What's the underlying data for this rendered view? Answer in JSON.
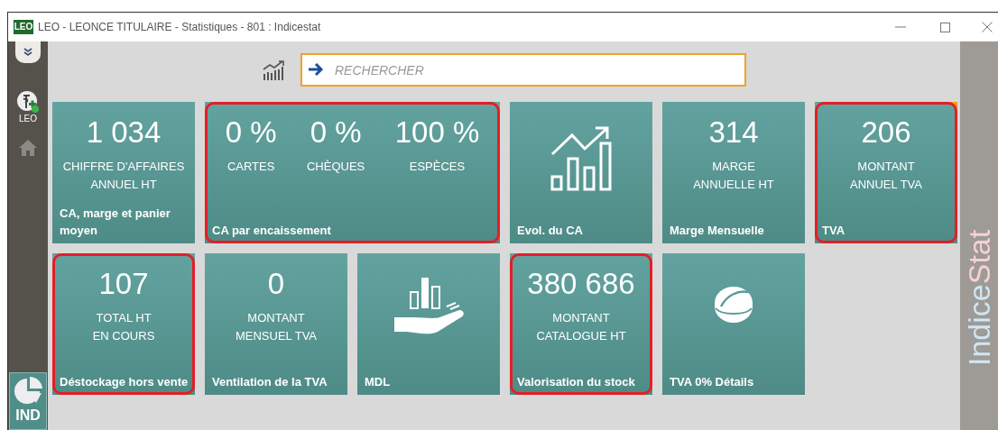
{
  "window": {
    "logo": "LEO",
    "title": "LEO - LEONCE TITULAIRE - Statistiques - 801 : Indicestat"
  },
  "sidebar": {
    "items": [
      {
        "kind": "user",
        "label": "LEO",
        "selected": false
      },
      {
        "kind": "home",
        "selected": false
      },
      {
        "kind": "module",
        "label": "IND",
        "selected": true
      }
    ]
  },
  "search": {
    "placeholder": "RECHERCHER"
  },
  "tiles": [
    {
      "kind": "figure",
      "value": "1 034",
      "label": "CHIFFRE D'AFFAIRES\nANNUEL HT",
      "title": "CA, marge et panier moyen",
      "highlighted": false,
      "flagged": false
    },
    {
      "kind": "split",
      "figures": [
        {
          "value": "0 %",
          "label": "CARTES"
        },
        {
          "value": "0 %",
          "label": "CHÈQUES"
        },
        {
          "value": "100 %",
          "label": "ESPÈCES"
        }
      ],
      "title": "CA par encaissement",
      "highlighted": true,
      "flagged": false
    },
    {
      "kind": "trend",
      "title": "Evol. du CA",
      "highlighted": false,
      "flagged": false
    },
    {
      "kind": "figure",
      "value": "314",
      "label": "MARGE\nANNUELLE HT",
      "title": "Marge Mensuelle",
      "highlighted": false,
      "flagged": false
    },
    {
      "kind": "figure",
      "value": "206",
      "label": "MONTANT\nANNUEL TVA",
      "title": "TVA",
      "highlighted": true,
      "flagged": true
    },
    {
      "kind": "figure",
      "value": "107",
      "label": "TOTAL HT\nEN COURS",
      "title": "Déstockage hors vente",
      "highlighted": true,
      "flagged": false
    },
    {
      "kind": "figure",
      "value": "0",
      "label": "MONTANT\nMENSUEL TVA",
      "title": "Ventilation de la TVA",
      "highlighted": false,
      "flagged": false
    },
    {
      "kind": "hand",
      "title": "MDL",
      "highlighted": false,
      "flagged": false
    },
    {
      "kind": "figure",
      "value": "380 686",
      "label": "MONTANT\nCATALOGUE HT",
      "title": "Valorisation du stock",
      "highlighted": true,
      "flagged": false
    },
    {
      "kind": "tablet",
      "title": "TVA 0% Détails",
      "highlighted": false,
      "flagged": false
    }
  ],
  "brand": [
    "Indice",
    "Stat"
  ]
}
